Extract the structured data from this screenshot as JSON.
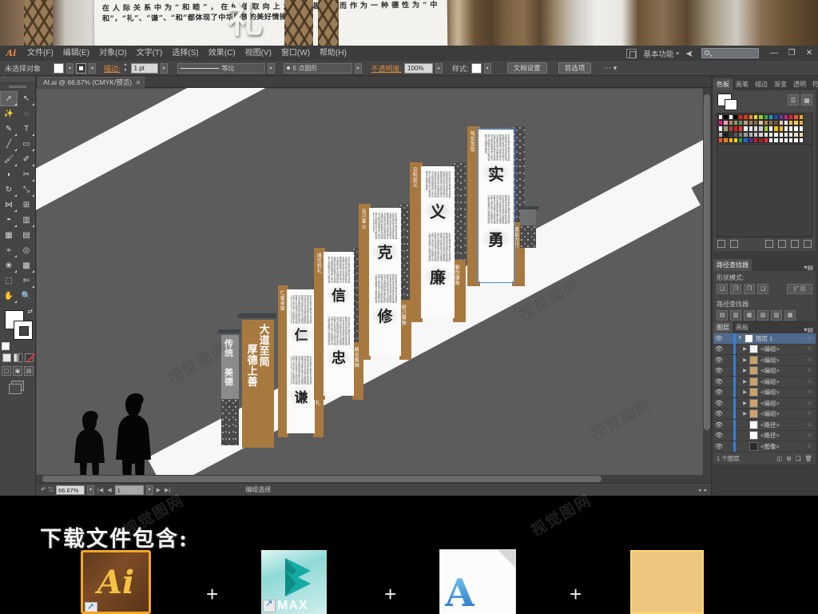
{
  "preview": {
    "body_text": "在人际关系中为“和睦”，在价值取向上为“和谐”，而作为一种德性为“中和”，“礼”、“谦”、“和”都体现了中华民族的美好情操。",
    "big_char": "礼"
  },
  "app": {
    "name": "Ai",
    "menus": [
      "文件(F)",
      "编辑(E)",
      "对象(O)",
      "文字(T)",
      "选择(S)",
      "效果(C)",
      "视图(V)",
      "窗口(W)",
      "帮助(H)"
    ],
    "workspace": "基本功能",
    "search_placeholder": "",
    "window_buttons": [
      "—",
      "❐",
      "✕"
    ]
  },
  "control_bar": {
    "selection_status": "未选择对象",
    "stroke_label": "描边:",
    "stroke_weight": "1 pt",
    "profile_label": "等比",
    "brush_label": "5 点圆形",
    "opacity_label": "不透明度:",
    "opacity_value": "100%",
    "style_label": "样式:",
    "doc_setup_button": "文档设置",
    "preferences_button": "首选项"
  },
  "document": {
    "tab_title": "AI.ai @ 66.67% (CMYK/预览)",
    "close_glyph": "✕"
  },
  "status_bar": {
    "zoom": "66.67%",
    "page": "1",
    "tool": "编组选择"
  },
  "panels": {
    "swatches": {
      "tabs": [
        "色板",
        "画笔",
        "描边",
        "渐变",
        "透明",
        "符号"
      ],
      "active_tab": "色板",
      "menu_glyph": "▾▤",
      "footer_icons": [
        "swatch-libraries-icon",
        "show-kinds-icon",
        "new-group-icon",
        "options-icon",
        "new-swatch-icon",
        "delete-icon"
      ],
      "colors": [
        [
          "#ffffff",
          "#000000",
          "#ffffff",
          "#000000",
          "#e8232a",
          "#e03a1c",
          "#f08c1e",
          "#f5d31a",
          "#9acd32",
          "#3aa93a",
          "#1a9ad7",
          "#1f4fa0",
          "#7b2fa0",
          "#c9208a",
          "#e8232a",
          "#f05a22",
          "#f5a81c"
        ],
        [
          "#e8107f",
          "#f0a0c0",
          "#b08a60",
          "#8f9a6a",
          "#6a8f6a",
          "#c0a070",
          "#a08050",
          "#8a6a40",
          "#d8c0a0",
          "#b08040",
          "#907040",
          "#6a5030",
          "#e0d0b0",
          "#ffffff",
          "#f0c040",
          "#f5d060",
          "#e0b030"
        ],
        [
          "#ffffff",
          "#9aa070",
          "#b04040",
          "#d02020",
          "#e04040",
          "#eeeeee",
          "#e8e8e8",
          "#dddddd",
          "#cccccc",
          "#9acd32",
          "#ffffff",
          "#f0c020",
          "#f0c020",
          "#ffffff",
          "#ffffff",
          "#ffffff",
          "#ffffff"
        ],
        [
          "#b0b0b0",
          "#1a1a1a",
          "#3a3a3a",
          "#5a5a5a",
          "#7a7a7a",
          "#9a9a9a",
          "#b4b4b4",
          "#c8c8c8",
          "#d8d8d8",
          "#e4e4e4",
          "#efefef",
          "#f8f8f8",
          "#ffffff",
          "#fff6e0",
          "#f6ecd8",
          "#efe0c0",
          "#e8d4a8"
        ],
        [
          "#f05a22",
          "#f0801a",
          "#f5b81a",
          "#f5d31a",
          "#2a9a4a",
          "#1a6ad0",
          "#5a2a9a",
          "#c0202a",
          "#a0202a",
          "#e02a2a",
          "#ffffff",
          "#ffffff",
          "#ffffff",
          "#ffffff",
          "#ffffff",
          "#ffffff",
          "#ffffff"
        ]
      ]
    },
    "pathfinder": {
      "tab": "路径查找器",
      "shape_modes_label": "形状模式:",
      "expand_button": "扩展",
      "pathfinders_label": "路径查找器:",
      "shape_mode_icons": [
        "unite-icon",
        "minus-front-icon",
        "intersect-icon",
        "exclude-icon"
      ],
      "pathfinder_icons": [
        "divide-icon",
        "trim-icon",
        "merge-icon",
        "crop-icon",
        "outline-icon",
        "minus-back-icon"
      ]
    },
    "layers": {
      "tabs": [
        "图层",
        "画板"
      ],
      "active_tab": "图层",
      "rows": [
        {
          "name": "图层 1",
          "selected": true,
          "expandable": true,
          "thumb": "#ffffff"
        },
        {
          "name": "<编组>",
          "selected": false,
          "expandable": true,
          "thumb": "#f2f2f2"
        },
        {
          "name": "<编组>",
          "selected": false,
          "expandable": true,
          "thumb": "#caa26a"
        },
        {
          "name": "<编组>",
          "selected": false,
          "expandable": true,
          "thumb": "#caa26a"
        },
        {
          "name": "<编组>",
          "selected": false,
          "expandable": true,
          "thumb": "#caa26a"
        },
        {
          "name": "<编组>",
          "selected": false,
          "expandable": true,
          "thumb": "#caa26a"
        },
        {
          "name": "<编组>",
          "selected": false,
          "expandable": true,
          "thumb": "#caa26a"
        },
        {
          "name": "<编组>",
          "selected": false,
          "expandable": true,
          "thumb": "#caa26a"
        },
        {
          "name": "<路径>",
          "selected": false,
          "expandable": false,
          "thumb": "#ffffff"
        },
        {
          "name": "<路径>",
          "selected": false,
          "expandable": false,
          "thumb": "#ffffff"
        },
        {
          "name": "<图像>",
          "selected": false,
          "expandable": false,
          "thumb": "#2a2a2a"
        }
      ],
      "footer": "1 个图层"
    }
  },
  "artwork": {
    "signs": [
      {
        "id": "sign-0",
        "big": [
          "传统",
          "美德"
        ],
        "kind": "gray-plaque"
      },
      {
        "id": "sign-1",
        "big": [
          "大道至简",
          "厚德上善"
        ],
        "kind": "gold-plaque"
      },
      {
        "id": "sign-2",
        "side_right": "仁爱孝悌",
        "big_top": "仁",
        "big_bottom": "谦",
        "side_left": "谦和好礼"
      },
      {
        "id": "sign-3",
        "side_right": "诚信知礼",
        "big_top": "信",
        "big_bottom": "忠",
        "side_left": "精忠报国"
      },
      {
        "id": "sign-4",
        "side_right": "克己奉公",
        "big_top": "克",
        "big_bottom": "修",
        "side_left": "修己慎独"
      },
      {
        "id": "sign-5",
        "side_right": "见利思义",
        "big_top": "义",
        "big_bottom": "廉",
        "side_left": "勤俭廉政"
      },
      {
        "id": "sign-6",
        "side_right": "笃实宽厚",
        "big_top": "实",
        "big_bottom": "勇",
        "side_left": "勇毅力行",
        "selected": true
      }
    ],
    "poem_block": "天地玄黄宇宙洪荒日月盈昃辰宿列张寒来暑往秋收冬藏闰余成岁律吕调阳云腾致雨露结为霜金生丽水玉出昆冈剑号巨阙珠称夜光果珍李柰菜重芥姜海咸河淡鳞潜羽翔龙师火帝鸟官人皇始制文字乃服衣裳推位让国有虞陶唐"
  },
  "downloads": {
    "title": "下载文件包含:",
    "plus": "+",
    "items": [
      {
        "name": "illustrator-file-icon",
        "label": "Ai"
      },
      {
        "name": "3dsmax-file-icon",
        "label": "MAX"
      },
      {
        "name": "font-file-icon",
        "label": "A"
      },
      {
        "name": "wood-texture-icon",
        "label": ""
      }
    ]
  },
  "watermark": {
    "text": "视觉图网"
  }
}
